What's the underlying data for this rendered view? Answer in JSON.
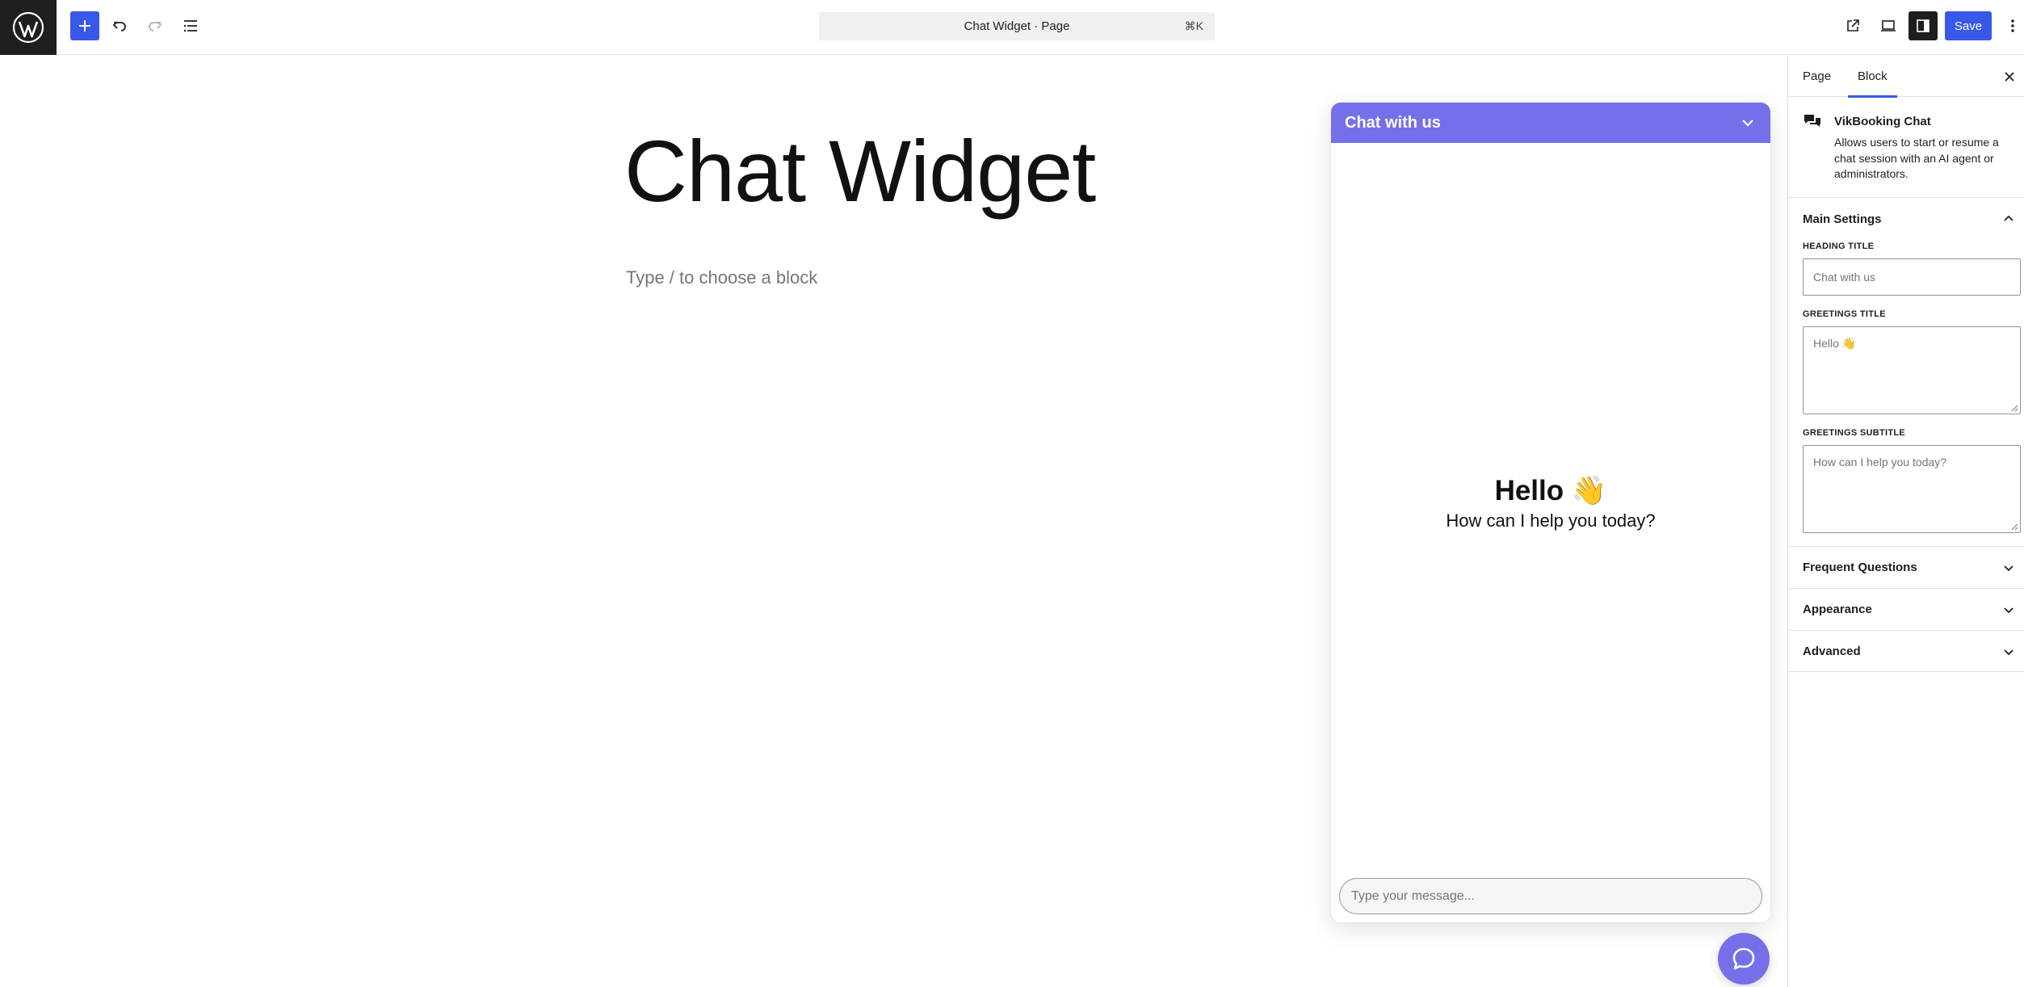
{
  "topbar": {
    "command_title": "Chat Widget · Page",
    "command_shortcut": "⌘K",
    "save_label": "Save"
  },
  "canvas": {
    "page_title": "Chat Widget",
    "block_placeholder": "Type / to choose a block"
  },
  "chat": {
    "heading": "Chat with us",
    "greeting_title": "Hello 👋",
    "greeting_subtitle": "How can I help you today?",
    "input_placeholder": "Type your message...",
    "accent_color": "#7570e9"
  },
  "sidebar": {
    "tabs": [
      {
        "label": "Page"
      },
      {
        "label": "Block"
      }
    ],
    "block": {
      "name": "VikBooking Chat",
      "description": "Allows users to start or resume a chat session with an AI agent or administrators."
    },
    "main_settings": {
      "label": "Main Settings",
      "heading_title_label": "Heading title",
      "heading_title_placeholder": "Chat with us",
      "greetings_title_label": "Greetings title",
      "greetings_title_placeholder": "Hello 👋",
      "greetings_subtitle_label": "Greetings subtitle",
      "greetings_subtitle_placeholder": "How can I help you today?"
    },
    "panels": [
      {
        "label": "Frequent Questions"
      },
      {
        "label": "Appearance"
      },
      {
        "label": "Advanced"
      }
    ]
  }
}
